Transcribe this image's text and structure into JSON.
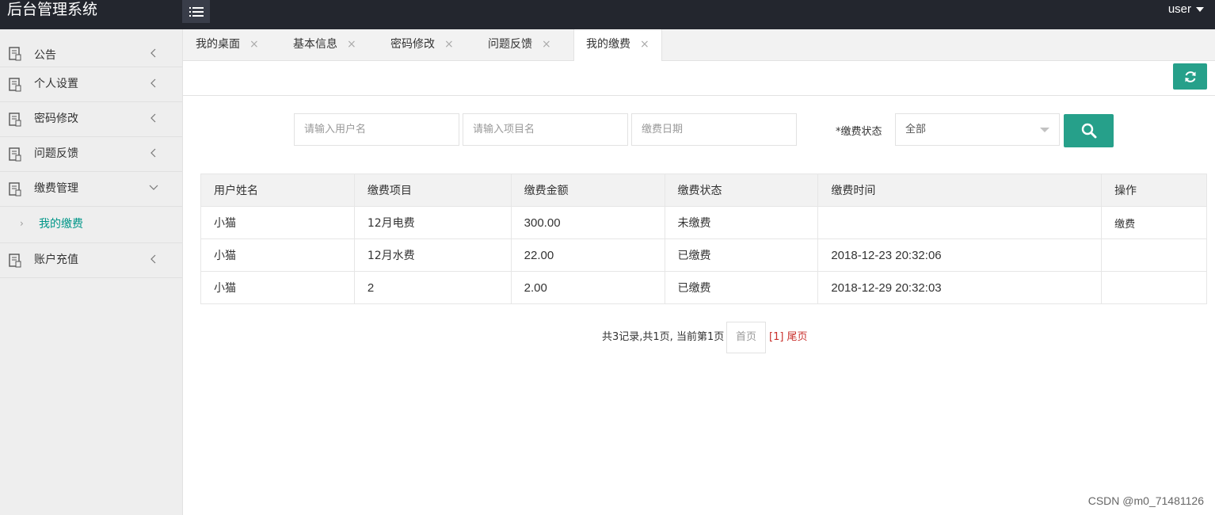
{
  "app": {
    "title": "后台管理系统",
    "user": "user"
  },
  "sidebar": {
    "items": [
      {
        "label": "公告"
      },
      {
        "label": "个人设置"
      },
      {
        "label": "密码修改"
      },
      {
        "label": "问题反馈"
      },
      {
        "label": "缴费管理"
      },
      {
        "label": "账户充值"
      }
    ],
    "subitems": [
      {
        "label": "我的缴费",
        "arrow": "›"
      }
    ]
  },
  "tabs": [
    {
      "label": "我的桌面",
      "close": "×"
    },
    {
      "label": "基本信息",
      "close": "×"
    },
    {
      "label": "密码修改",
      "close": "×"
    },
    {
      "label": "问题反馈",
      "close": "×"
    },
    {
      "label": "我的缴费",
      "close": "×"
    }
  ],
  "search": {
    "username_placeholder": "请输入用户名",
    "project_placeholder": "请输入项目名",
    "date_placeholder": "缴费日期",
    "status_label": "*缴费状态",
    "status_selected": "全部"
  },
  "table": {
    "headers": [
      "用户姓名",
      "缴费项目",
      "缴费金额",
      "缴费状态",
      "缴费时间",
      "操作"
    ],
    "rows": [
      {
        "name": "小猫",
        "project": "12月电费",
        "amount": "300.00",
        "status": "未缴费",
        "time": "",
        "action": "缴费"
      },
      {
        "name": "小猫",
        "project": "12月水费",
        "amount": "22.00",
        "status": "已缴费",
        "time": "2018-12-23 20:32:06",
        "action": ""
      },
      {
        "name": "小猫",
        "project": "2",
        "amount": "2.00",
        "status": "已缴费",
        "time": "2018-12-29 20:32:03",
        "action": ""
      }
    ]
  },
  "pagination": {
    "info": "共3记录,共1页, 当前第1页",
    "first": "首页",
    "current": "[1] 尾页"
  },
  "watermark": "CSDN @m0_71481126",
  "colors": {
    "accent": "#26a08a",
    "topbar": "#23262e",
    "active_sub": "#009688",
    "pager_current": "#c9302c"
  },
  "icons": {
    "menu": "menu-lines-icon",
    "nav": "document-icon",
    "collapse": "chevron-left-icon",
    "expand": "chevron-down-icon",
    "refresh": "refresh-icon",
    "search": "search-icon",
    "dropdown": "caret-down-icon"
  }
}
